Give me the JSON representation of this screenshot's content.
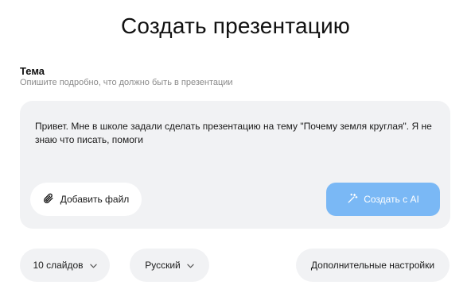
{
  "header": {
    "title": "Создать презентацию"
  },
  "topic": {
    "label": "Тема",
    "hint": "Опишите подробно, что должно быть в презентации",
    "text": "Привет. Мне в школе задали сделать презентацию на тему \"Почему земля круглая\". Я не знаю что писать, помоги"
  },
  "actions": {
    "attach_label": "Добавить файл",
    "attach_icon": "paperclip-icon",
    "create_label": "Создать с AI",
    "create_icon": "magic-wand-icon",
    "create_color": "#7ab8f5"
  },
  "options": {
    "slides_value": "10 слайдов",
    "language_value": "Русский",
    "more_label": "Дополнительные настройки",
    "dropdown_icon": "chevron-down-icon"
  },
  "colors": {
    "card_background": "#f1f2f4",
    "hint_text": "#8a8a8a"
  }
}
